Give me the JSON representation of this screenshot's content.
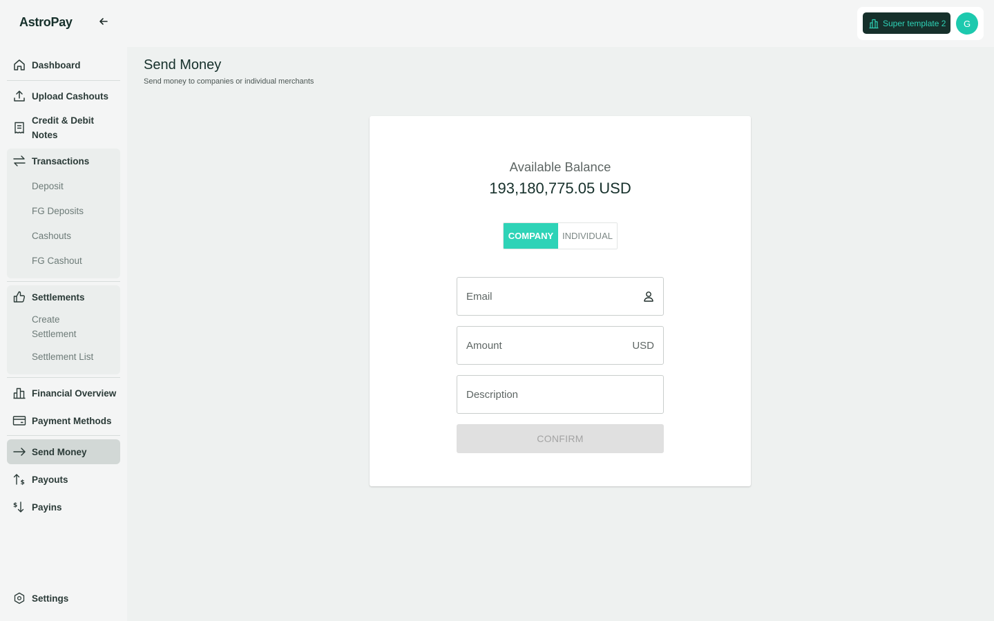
{
  "app": {
    "logo": "AstroPay",
    "collapse_icon": "arrow-left-icon"
  },
  "account": {
    "template_label": "Super template 2",
    "avatar_initial": "G"
  },
  "sidebar": {
    "dashboard": "Dashboard",
    "upload_cashouts": "Upload Cashouts",
    "credit_debit_line1": "Credit & Debit",
    "credit_debit_line2": "Notes",
    "transactions": "Transactions",
    "transactions_sub": [
      "Deposit",
      "FG Deposits",
      "Cashouts",
      "FG Cashout"
    ],
    "settlements": "Settlements",
    "create_settlement_line1": "Create",
    "create_settlement_line2": "Settlement",
    "settlement_list": "Settlement List",
    "financial_overview": "Financial Overview",
    "payment_methods": "Payment Methods",
    "send_money": "Send Money",
    "payouts": "Payouts",
    "payins": "Payins",
    "settings": "Settings"
  },
  "page": {
    "title": "Send Money",
    "subtitle": "Send money to companies or individual merchants"
  },
  "card": {
    "balance_label": "Available Balance",
    "balance_value": "193,180,775.05 USD",
    "toggle_company": "COMPANY",
    "toggle_individual": "INDIVIDUAL",
    "selected": "COMPANY",
    "email_placeholder": "Email",
    "amount_placeholder": "Amount",
    "amount_currency": "USD",
    "description_placeholder": "Description",
    "confirm_label": "CONFIRM"
  },
  "colors": {
    "accent": "#2ed3b7",
    "brand_dark": "#16302b",
    "avatar": "#1dc9ae"
  }
}
